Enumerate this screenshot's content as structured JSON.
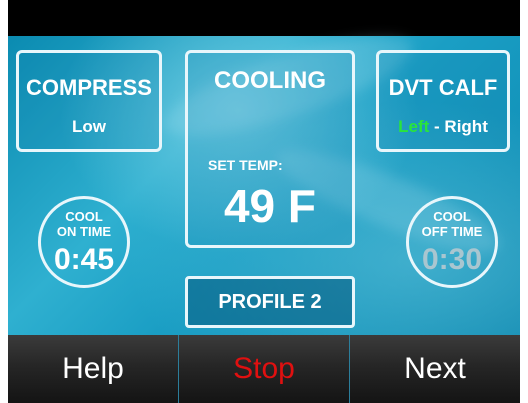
{
  "panels": {
    "compress": {
      "title": "COMPRESS",
      "value": "Low"
    },
    "cooling": {
      "title": "COOLING",
      "set_temp_label": "SET TEMP:",
      "set_temp_value": "49 F"
    },
    "dvt": {
      "title": "DVT CALF",
      "left": "Left",
      "separator": " - ",
      "right": "Right"
    }
  },
  "timers": {
    "on": {
      "line1": "COOL",
      "line2": "ON TIME",
      "value": "0:45"
    },
    "off": {
      "line1": "COOL",
      "line2": "OFF TIME",
      "value": "0:30"
    }
  },
  "profile": {
    "label": "PROFILE 2"
  },
  "bottom_bar": {
    "help": "Help",
    "stop": "Stop",
    "next": "Next"
  },
  "colors": {
    "screen_accent": "#1a9ec4",
    "selected_side": "#29e53b",
    "stop": "#e01010",
    "inactive_timer": "#a9c6d0"
  }
}
